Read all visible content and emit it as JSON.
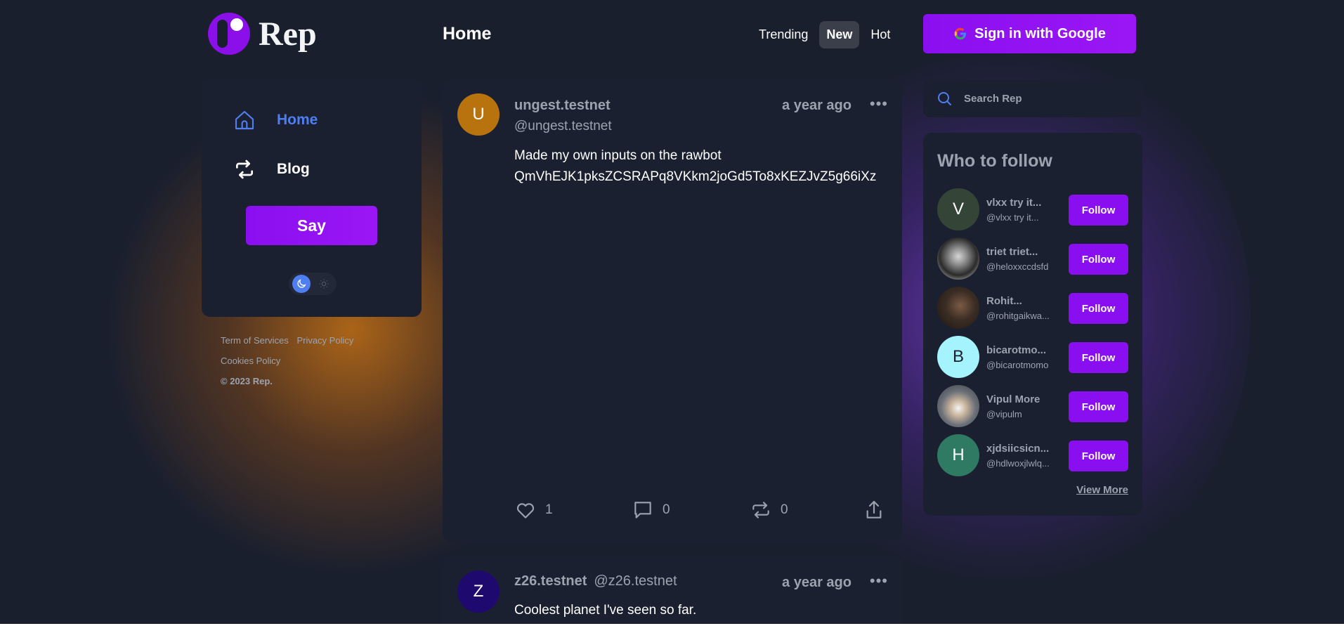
{
  "brand": {
    "name": "Rep",
    "accent": "#8a0ff0",
    "link_blue": "#4f7ef0"
  },
  "header": {
    "title": "Home",
    "tabs": [
      {
        "label": "Trending",
        "active": false
      },
      {
        "label": "New",
        "active": true
      },
      {
        "label": "Hot",
        "active": false
      }
    ],
    "signin_label": "Sign in with Google"
  },
  "sidebar": {
    "items": [
      {
        "label": "Home",
        "icon": "home-icon",
        "active": true
      },
      {
        "label": "Blog",
        "icon": "repost-icon",
        "active": false
      }
    ],
    "say_label": "Say",
    "theme": {
      "selected": "dark"
    }
  },
  "footer": {
    "terms": "Term of Services",
    "privacy": "Privacy Policy",
    "cookies": "Cookies Policy",
    "copyright": "© 2023 Rep."
  },
  "feed": {
    "posts": [
      {
        "avatar_letter": "U",
        "avatar_color": "#b8730f",
        "name": "ungest.testnet",
        "handle": "@ungest.testnet",
        "time": "a year ago",
        "body_line1": "Made my own inputs on the rawbot",
        "body_line2": "QmVhEJK1pksZCSRAPq8VKkm2joGd5To8xKEZJvZ5g66iXz",
        "likes": "1",
        "comments": "0",
        "reposts": "0"
      },
      {
        "avatar_letter": "Z",
        "avatar_color": "#1e0a6e",
        "name": "z26.testnet",
        "handle": "@z26.testnet",
        "time": "a year ago",
        "body": "Coolest planet I've seen so far."
      }
    ]
  },
  "search": {
    "placeholder": "Search Rep"
  },
  "who_to_follow": {
    "title": "Who to follow",
    "follow_label": "Follow",
    "view_more": "View More",
    "users": [
      {
        "letter": "V",
        "avatar_color": "#344436",
        "name": "vlxx try it...",
        "handle": "@vlxx try it..."
      },
      {
        "letter": "",
        "avatar_color": "#2a2a2a",
        "name": "triet triet...",
        "handle": "@heloxxccdsfd"
      },
      {
        "letter": "",
        "avatar_color": "#3b2d24",
        "name": "Rohit...",
        "handle": "@rohitgaikwa..."
      },
      {
        "letter": "B",
        "avatar_color": "#a5f3fc",
        "name": "bicarotmo...",
        "handle": "@bicarotmomo"
      },
      {
        "letter": "",
        "avatar_color": "#6b6f78",
        "name": "Vipul More",
        "handle": "@vipulm"
      },
      {
        "letter": "H",
        "avatar_color": "#2f7a63",
        "name": "xjdsiicsicn...",
        "handle": "@hdlwoxjlwlq..."
      }
    ]
  }
}
